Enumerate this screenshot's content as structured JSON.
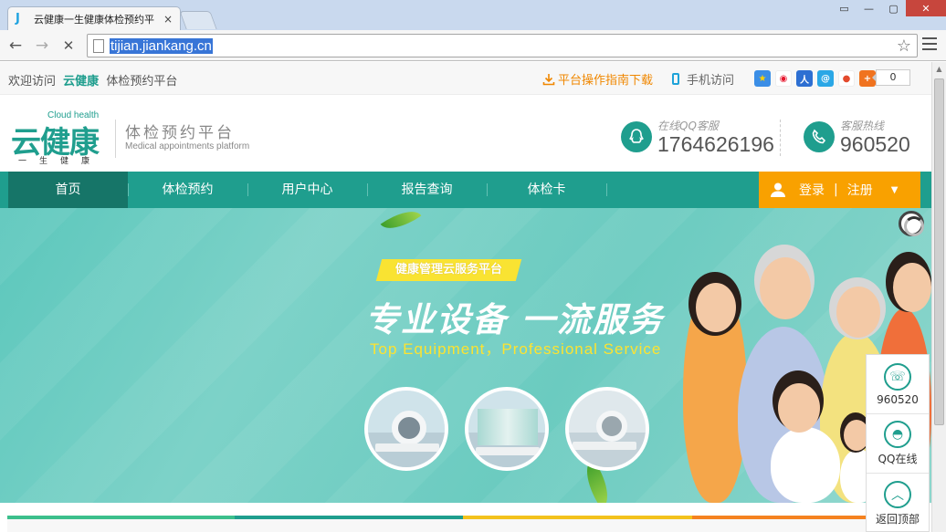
{
  "browser": {
    "tab_title": "云健康一生健康体检预约平",
    "tab_close": "×",
    "url": "tijian.jiankang.cn",
    "back_icon": "←",
    "forward_icon": "→",
    "stop_icon": "✕",
    "star_icon": "☆"
  },
  "topbar": {
    "welcome_prefix": "欢迎访问",
    "brand": "云健康",
    "welcome_suffix": "体检预约平台",
    "guide_link": "平台操作指南下载",
    "mobile_link": "手机访问",
    "share_count": "0"
  },
  "header": {
    "logo_en": "Cloud health",
    "logo_cn": "云健康",
    "logo_sub": "一生健康",
    "platform_cn": "体检预约平台",
    "platform_en": "Medical appointments platform",
    "qq_label": "在线QQ客服",
    "qq_number": "1764626196",
    "hotline_label": "客服热线",
    "hotline_number": "960520"
  },
  "nav": {
    "items": [
      "首页",
      "体检预约",
      "用户中心",
      "报告查询",
      "体检卡"
    ],
    "login": "登录",
    "separator": "|",
    "register": "注册"
  },
  "banner": {
    "tag": "健康管理云服务平台",
    "headline": "专业设备 一流服务",
    "subline": "Top Equipment，Professional Service"
  },
  "side_float": {
    "phone": "960520",
    "qq": "QQ在线",
    "top": "返回顶部"
  },
  "colors": {
    "brand_teal": "#1f9e8e",
    "nav_active": "#167568",
    "login_orange": "#f9a100",
    "tag_yellow": "#f9e332"
  }
}
